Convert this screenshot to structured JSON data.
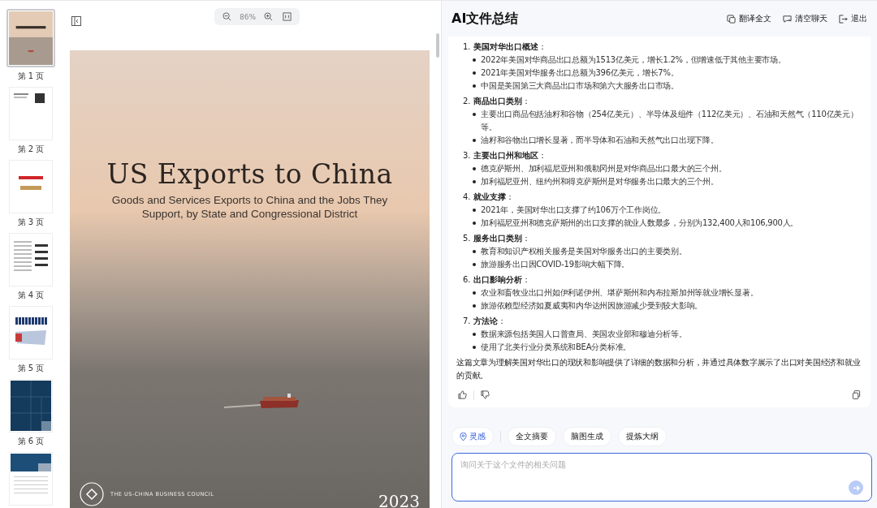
{
  "viewer": {
    "thumbnails": [
      {
        "label": "第 1 页",
        "kind": "cover",
        "selected": true
      },
      {
        "label": "第 2 页",
        "kind": "qr",
        "selected": false
      },
      {
        "label": "第 3 页",
        "kind": "logos",
        "selected": false
      },
      {
        "label": "第 4 页",
        "kind": "text",
        "selected": false
      },
      {
        "label": "第 5 页",
        "kind": "map",
        "selected": false
      },
      {
        "label": "第 6 页",
        "kind": "treemap",
        "selected": false
      },
      {
        "kind": "table",
        "selected": false
      }
    ],
    "zoom": "86%",
    "page": {
      "title": "US Exports to China",
      "subtitle": "Goods and Services Exports to China and the Jobs They Support, by State and Congressional District",
      "publisher": "THE US-CHINA BUSINESS COUNCIL",
      "year": "2023"
    }
  },
  "chat": {
    "title": "AI文件总结",
    "actions": [
      {
        "label": "翻译全文",
        "kind": "translate"
      },
      {
        "label": "清空聊天",
        "kind": "clear"
      },
      {
        "label": "退出",
        "kind": "exit"
      }
    ],
    "sections": [
      {
        "heading": "1. **美国对华出口概述**：",
        "bullets": [
          "2022年美国对华商品出口总额为1513亿美元，增长1.2%，但增速低于其他主要市场。",
          "2021年美国对华服务出口总额为396亿美元，增长7%。",
          "中国是美国第三大商品出口市场和第六大服务出口市场。"
        ]
      },
      {
        "heading": "2. **商品出口类别**：",
        "bullets": [
          "主要出口商品包括油籽和谷物（254亿美元）、半导体及组件（112亿美元）、石油和天然气（110亿美元）等。",
          "油籽和谷物出口增长显著，而半导体和石油和天然气出口出现下降。"
        ]
      },
      {
        "heading": "3. **主要出口州和地区**：",
        "bullets": [
          "德克萨斯州、加利福尼亚州和俄勒冈州是对华商品出口最大的三个州。",
          "加利福尼亚州、纽约州和得克萨斯州是对华服务出口最大的三个州。"
        ]
      },
      {
        "heading": "4. **就业支撑**：",
        "bullets": [
          "2021年，美国对华出口支撑了约106万个工作岗位。",
          "加利福尼亚州和德克萨斯州的出口支撑的就业人数最多，分别为132,400人和106,900人。"
        ]
      },
      {
        "heading": "5. **服务出口类别**：",
        "bullets": [
          "教育和知识产权相关服务是美国对华服务出口的主要类别。",
          "旅游服务出口因COVID-19影响大幅下降。"
        ]
      },
      {
        "heading": "6. **出口影响分析**：",
        "bullets": [
          "农业和畜牧业出口州如伊利诺伊州、堪萨斯州和内布拉斯加州等就业增长显著。",
          "旅游依赖型经济如夏威夷和内华达州因旅游减少受到较大影响。"
        ]
      },
      {
        "heading": "7. **方法论**：",
        "bullets": [
          "数据来源包括美国人口普查局、美国农业部和穆迪分析等。",
          "使用了北美行业分类系统和BEA分类标准。"
        ]
      }
    ],
    "conclusion": "这篇文章为理解美国对华出口的现状和影响提供了详细的数据和分析，并通过具体数字展示了出口对美国经济和就业的贡献。",
    "chips": [
      {
        "label": "灵感",
        "kind": "accent"
      },
      {
        "label": "全文摘要",
        "kind": "plain"
      },
      {
        "label": "脑图生成",
        "kind": "plain"
      },
      {
        "label": "提炼大纲",
        "kind": "plain"
      }
    ],
    "input": {
      "placeholder": "询问关于这个文件的相关问题"
    }
  }
}
